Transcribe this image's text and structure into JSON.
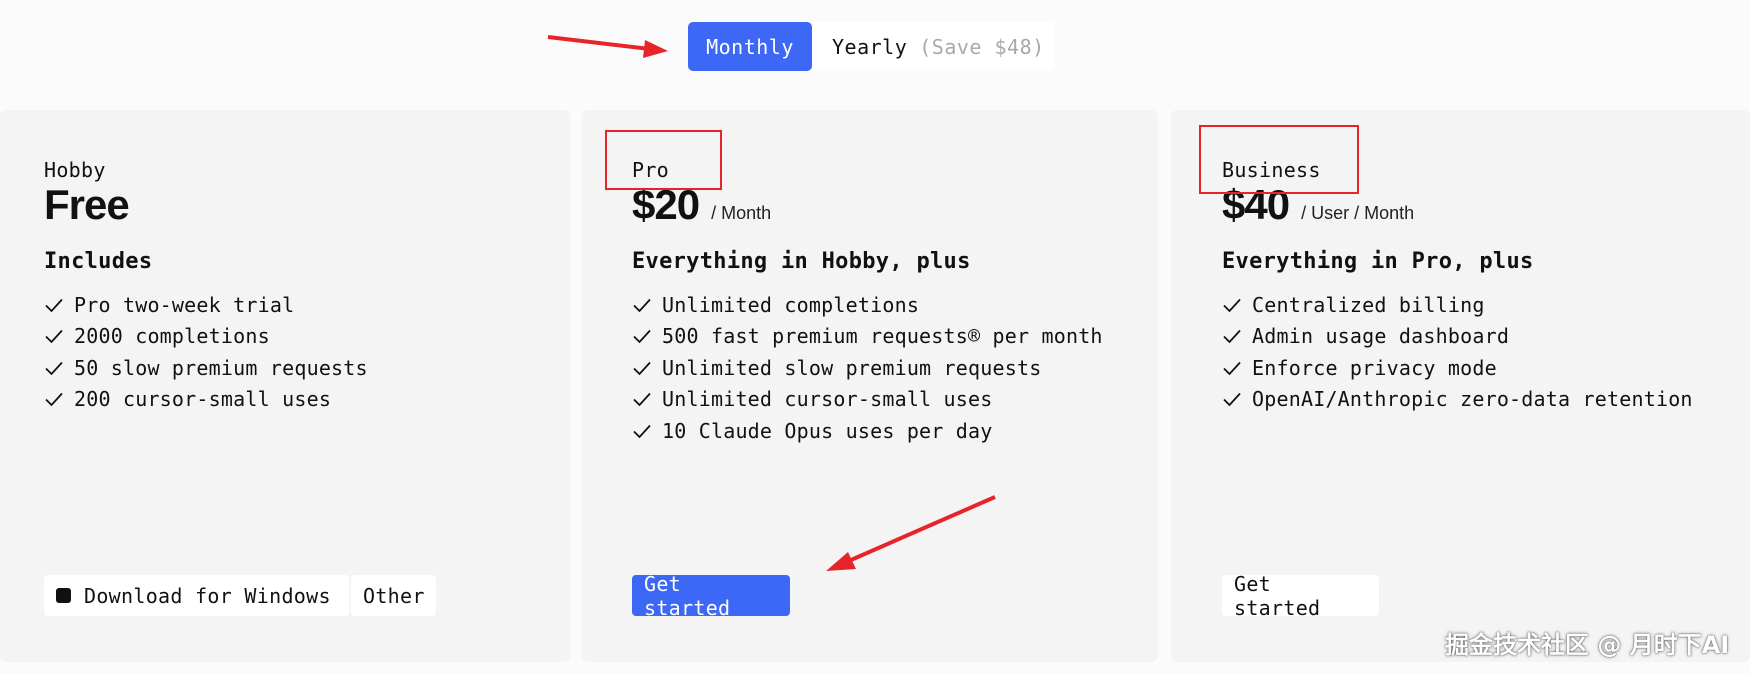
{
  "billing_toggle": {
    "monthly_label": "Monthly",
    "yearly_label": "Yearly",
    "yearly_save": "(Save $48)",
    "selected": "Monthly"
  },
  "plans": [
    {
      "name": "Hobby",
      "price": "Free",
      "price_unit": "",
      "features_title": "Includes",
      "features": [
        "Pro two-week trial",
        "2000 completions",
        "50 slow premium requests",
        "200 cursor-small uses"
      ],
      "buttons": [
        "Download for Windows",
        "Other"
      ]
    },
    {
      "name": "Pro",
      "price": "$20",
      "price_unit": "/ Month",
      "features_title": "Everything in Hobby, plus",
      "features": [
        "Unlimited completions",
        "500 fast premium requests® per month",
        "Unlimited slow premium requests",
        "Unlimited cursor-small uses",
        "10 Claude Opus uses per day"
      ],
      "buttons": [
        "Get started"
      ]
    },
    {
      "name": "Business",
      "price": "$40",
      "price_unit": "/ User / Month",
      "features_title": "Everything in Pro, plus",
      "features": [
        "Centralized billing",
        "Admin usage dashboard",
        "Enforce privacy mode",
        "OpenAI/Anthropic zero-data retention"
      ],
      "buttons": [
        "Get started"
      ]
    }
  ],
  "watermark": "掘金技术社区 @ 月时下AI",
  "colors": {
    "accent": "#3d67f5",
    "annotation": "#e8242b",
    "card_bg": "#f4f4f4",
    "page_bg": "#fbfbfb"
  },
  "icons": {
    "check": "check-icon",
    "windows": "windows-icon",
    "annotation_arrow": "red-arrow-icon"
  }
}
